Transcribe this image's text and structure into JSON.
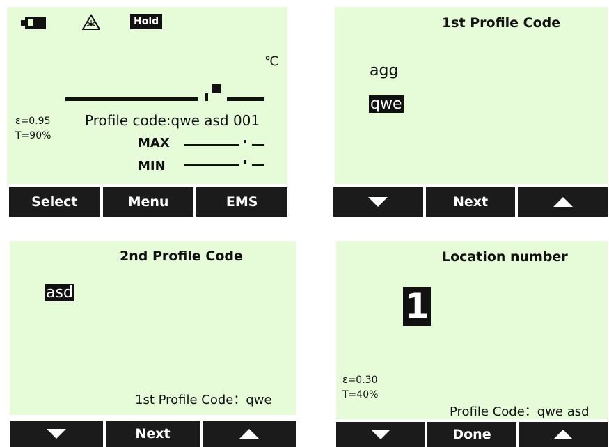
{
  "panel1": {
    "hold_badge": "Hold",
    "unit": "℃",
    "emissivity": "ε=0.95",
    "transmission": "T=90%",
    "profile_code": "Profile code:qwe asd 001",
    "max_label": "MAX",
    "min_label": "MIN",
    "softkeys": [
      "Select",
      "Menu",
      "EMS"
    ]
  },
  "panel2": {
    "title": "1st Profile Code",
    "options": [
      "agg",
      "qwe"
    ],
    "selected": "qwe",
    "next_label": "Next"
  },
  "panel3": {
    "title": "2nd Profile Code",
    "selected": "asd",
    "footer": "1st Profile Code：qwe",
    "next_label": "Next"
  },
  "panel4": {
    "title": "Location number",
    "value": "1",
    "emissivity": "ε=0.30",
    "transmission": "T=40%",
    "footer": "Profile Code：qwe asd",
    "done_label": "Done"
  },
  "icons": [
    "battery-icon",
    "laser-warning-icon",
    "arrow-down-icon",
    "arrow-up-icon"
  ],
  "colors": {
    "lcd_background": "#e6fbd8",
    "softkey_background": "#1b1b1b"
  }
}
